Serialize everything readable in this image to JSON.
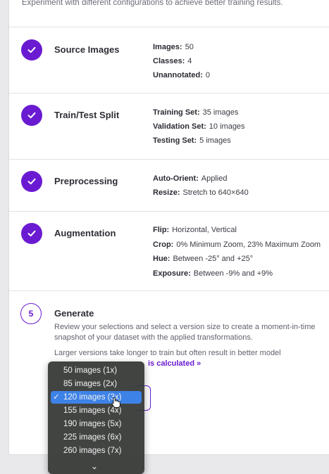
{
  "intro_text": "Experiment with different configurations to achieve better training results.",
  "steps": [
    {
      "title": "Source Images",
      "details": [
        {
          "label": "Images:",
          "value": "50"
        },
        {
          "label": "Classes:",
          "value": "4"
        },
        {
          "label": "Unannotated:",
          "value": "0"
        }
      ]
    },
    {
      "title": "Train/Test Split",
      "details": [
        {
          "label": "Training Set:",
          "value": "35 images"
        },
        {
          "label": "Validation Set:",
          "value": "10 images"
        },
        {
          "label": "Testing Set:",
          "value": "5 images"
        }
      ]
    },
    {
      "title": "Preprocessing",
      "details": [
        {
          "label": "Auto-Orient:",
          "value": "Applied"
        },
        {
          "label": "Resize:",
          "value": "Stretch to 640×640"
        }
      ]
    },
    {
      "title": "Augmentation",
      "details": [
        {
          "label": "Flip:",
          "value": "Horizontal, Vertical"
        },
        {
          "label": "Crop:",
          "value": "0% Minimum Zoom, 23% Maximum Zoom"
        },
        {
          "label": "Hue:",
          "value": "Between -25° and +25°"
        },
        {
          "label": "Exposure:",
          "value": "Between -9% and +9%"
        }
      ]
    }
  ],
  "generate": {
    "number": "5",
    "title": "Generate",
    "description_line1": "Review your selections and select a version size to create a moment-in-time",
    "description_line2": "snapshot of your dataset with the applied transformations.",
    "note_line1": "Larger versions take longer to train but often result in better model",
    "link_text": "is calculated »"
  },
  "version_size_dropdown": {
    "options": [
      "50 images (1x)",
      "85 images (2x)",
      "120 images (3x)",
      "155 images (4x)",
      "190 images (5x)",
      "225 images (6x)",
      "260 images (7x)"
    ],
    "selected_index": 2,
    "check_glyph": "✓",
    "more_glyph": "⌄"
  },
  "colors": {
    "accent": "#6a1bd1",
    "selection": "#3d82e6",
    "dropdown_bg": "#343634"
  }
}
